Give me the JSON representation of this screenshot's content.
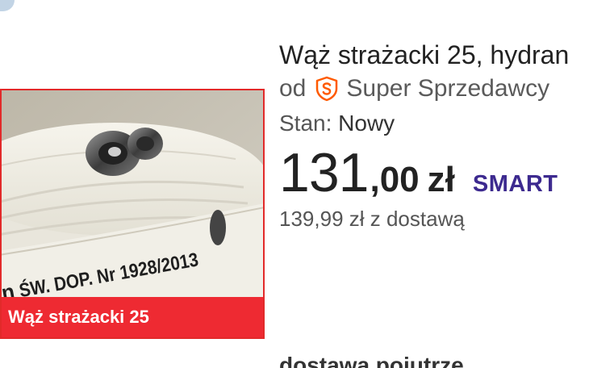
{
  "product": {
    "title": "Wąż strażacki 25, hydran",
    "image_caption": "Wąż strażacki 25",
    "image_print": "ŚW. DOP. Nr 1928/2013",
    "image_print_prefix": "n"
  },
  "seller": {
    "prefix": "od",
    "badge_icon": "super-seller-icon",
    "badge_color": "#ff5a00",
    "label": "Super Sprzedawcy"
  },
  "condition": {
    "label": "Stan:",
    "value": "Nowy"
  },
  "price": {
    "integer": "131",
    "fraction": ",00",
    "currency": "zł",
    "smart_label": "SMART",
    "smart_color": "#3d2a8f"
  },
  "delivery": {
    "total": "139,99 zł z dostawą",
    "note": "dostawa pojutrze"
  },
  "colors": {
    "caption_red": "#ee2a32",
    "text_dark": "#222222",
    "text_muted": "#555555"
  }
}
